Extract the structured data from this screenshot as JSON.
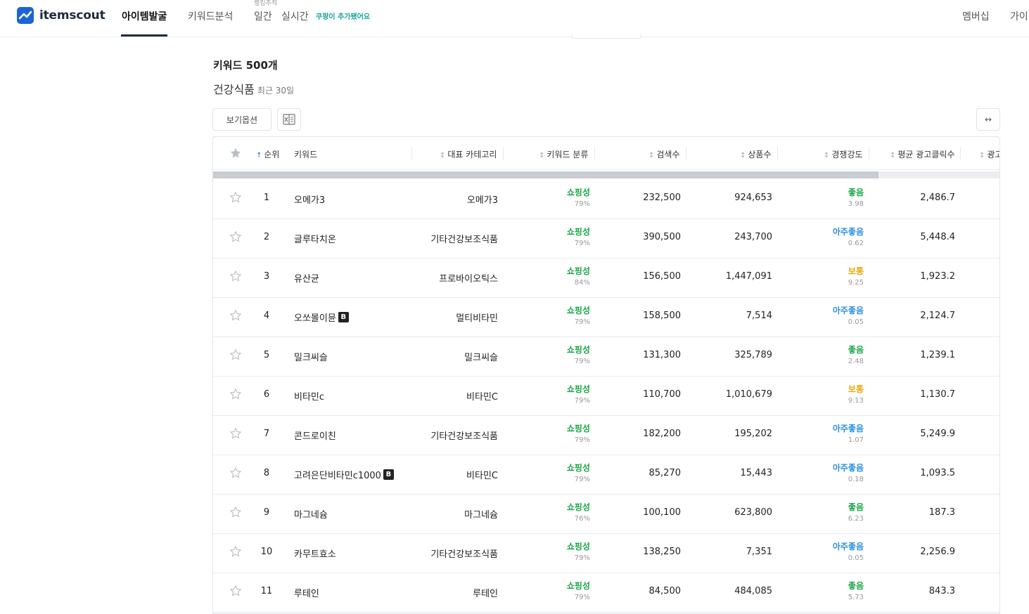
{
  "brand": {
    "name": "itemscout",
    "color": "#1a64d6"
  },
  "nav": {
    "items": [
      "아이템발굴",
      "키워드분석",
      "일간",
      "실시간"
    ],
    "rank_sub": "랭킹추적",
    "coupang_note": "쿠팡이 추가됐어요",
    "right": [
      "멤버십",
      "가이"
    ]
  },
  "page": {
    "title": "키워드 500개",
    "category": "건강식품",
    "period": "최근 30일",
    "view_options": "보기옵션",
    "expand_icon": "↔"
  },
  "columns": {
    "rank": "순위",
    "keyword": "키워드",
    "category": "대표 카테고리",
    "type": "키워드 분류",
    "search": "검색수",
    "products": "상품수",
    "competition": "경쟁강도",
    "avg_click": "평균 광고클릭수",
    "ad": "광고"
  },
  "colors": {
    "good": "#1aa548",
    "very_good": "#2b8fe0",
    "normal": "#f0a500"
  },
  "rows": [
    {
      "rank": "1",
      "keyword": "오메가3",
      "badge": "",
      "category": "오메가3",
      "type": "쇼핑성",
      "type_pct": "79%",
      "search": "232,500",
      "products": "924,653",
      "comp": "좋음",
      "comp_score": "3.98",
      "comp_level": "good",
      "click": "2,486.7"
    },
    {
      "rank": "2",
      "keyword": "글루타치온",
      "badge": "",
      "category": "기타건강보조식품",
      "type": "쇼핑성",
      "type_pct": "79%",
      "search": "390,500",
      "products": "243,700",
      "comp": "아주좋음",
      "comp_score": "0.62",
      "comp_level": "very_good",
      "click": "5,448.4"
    },
    {
      "rank": "3",
      "keyword": "유산균",
      "badge": "",
      "category": "프로바이오틱스",
      "type": "쇼핑성",
      "type_pct": "84%",
      "search": "156,500",
      "products": "1,447,091",
      "comp": "보통",
      "comp_score": "9.25",
      "comp_level": "normal",
      "click": "1,923.2"
    },
    {
      "rank": "4",
      "keyword": "오쏘몰이뮨",
      "badge": "B",
      "category": "멀티비타민",
      "type": "쇼핑성",
      "type_pct": "79%",
      "search": "158,500",
      "products": "7,514",
      "comp": "아주좋음",
      "comp_score": "0.05",
      "comp_level": "very_good",
      "click": "2,124.7"
    },
    {
      "rank": "5",
      "keyword": "밀크씨슬",
      "badge": "",
      "category": "밀크씨슬",
      "type": "쇼핑성",
      "type_pct": "79%",
      "search": "131,300",
      "products": "325,789",
      "comp": "좋음",
      "comp_score": "2.48",
      "comp_level": "good",
      "click": "1,239.1"
    },
    {
      "rank": "6",
      "keyword": "비타민c",
      "badge": "",
      "category": "비타민C",
      "type": "쇼핑성",
      "type_pct": "79%",
      "search": "110,700",
      "products": "1,010,679",
      "comp": "보통",
      "comp_score": "9.13",
      "comp_level": "normal",
      "click": "1,130.7"
    },
    {
      "rank": "7",
      "keyword": "콘드로이친",
      "badge": "",
      "category": "기타건강보조식품",
      "type": "쇼핑성",
      "type_pct": "79%",
      "search": "182,200",
      "products": "195,202",
      "comp": "아주좋음",
      "comp_score": "1.07",
      "comp_level": "very_good",
      "click": "5,249.9"
    },
    {
      "rank": "8",
      "keyword": "고려은단비타민c1000",
      "badge": "B",
      "category": "비타민C",
      "type": "쇼핑성",
      "type_pct": "79%",
      "search": "85,270",
      "products": "15,443",
      "comp": "아주좋음",
      "comp_score": "0.18",
      "comp_level": "very_good",
      "click": "1,093.5"
    },
    {
      "rank": "9",
      "keyword": "마그네슘",
      "badge": "",
      "category": "마그네슘",
      "type": "쇼핑성",
      "type_pct": "76%",
      "search": "100,100",
      "products": "623,800",
      "comp": "좋음",
      "comp_score": "6.23",
      "comp_level": "good",
      "click": "187.3"
    },
    {
      "rank": "10",
      "keyword": "카무트효소",
      "badge": "",
      "category": "기타건강보조식품",
      "type": "쇼핑성",
      "type_pct": "79%",
      "search": "138,250",
      "products": "7,351",
      "comp": "아주좋음",
      "comp_score": "0.05",
      "comp_level": "very_good",
      "click": "2,256.9"
    },
    {
      "rank": "11",
      "keyword": "루테인",
      "badge": "",
      "category": "루테인",
      "type": "쇼핑성",
      "type_pct": "79%",
      "search": "84,500",
      "products": "484,085",
      "comp": "좋음",
      "comp_score": "5.73",
      "comp_level": "good",
      "click": "843.3"
    }
  ]
}
